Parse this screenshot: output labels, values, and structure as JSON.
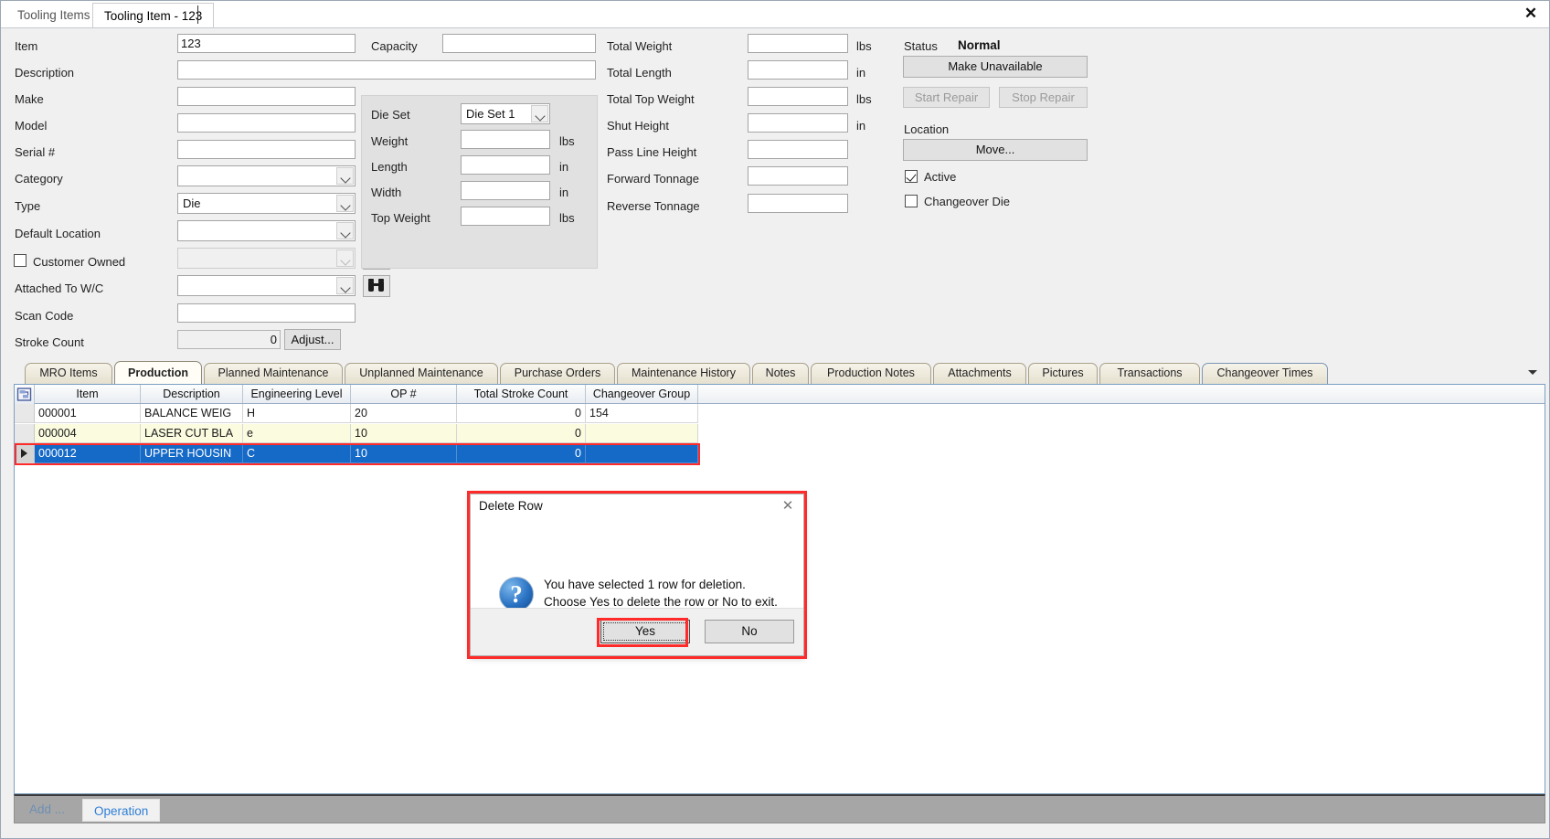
{
  "window": {
    "close_label": "✕"
  },
  "doc_tabs": [
    {
      "label": "Tooling Items",
      "active": false
    },
    {
      "label": "Tooling Item - 123",
      "active": true
    }
  ],
  "form": {
    "left_fields": [
      {
        "label": "Item",
        "value": "123",
        "type": "text"
      },
      {
        "label": "Description",
        "value": "",
        "type": "text"
      },
      {
        "label": "Make",
        "value": "",
        "type": "text"
      },
      {
        "label": "Model",
        "value": "",
        "type": "text"
      },
      {
        "label": "Serial #",
        "value": "",
        "type": "text"
      },
      {
        "label": "Category",
        "value": "",
        "type": "combo"
      },
      {
        "label": "Type",
        "value": "Die",
        "type": "combo"
      },
      {
        "label": "Default Location",
        "value": "",
        "type": "combo"
      },
      {
        "label": "Customer Owned",
        "value": "",
        "type": "checkbox-combo"
      },
      {
        "label": "Attached To W/C",
        "value": "",
        "type": "combo"
      },
      {
        "label": "Scan Code",
        "value": "",
        "type": "text"
      },
      {
        "label": "Stroke Count",
        "value": "0",
        "type": "readonly"
      }
    ],
    "capacity": {
      "label": "Capacity",
      "value": ""
    },
    "adjust_button": "Adjust...",
    "die_set_group": {
      "fields": [
        {
          "label": "Die Set",
          "value": "Die Set 1",
          "unit": "",
          "type": "combo"
        },
        {
          "label": "Weight",
          "value": "",
          "unit": "lbs",
          "type": "text"
        },
        {
          "label": "Length",
          "value": "",
          "unit": "in",
          "type": "text"
        },
        {
          "label": "Width",
          "value": "",
          "unit": "in",
          "type": "text"
        },
        {
          "label": "Top Weight",
          "value": "",
          "unit": "lbs",
          "type": "text"
        }
      ]
    },
    "totals": [
      {
        "label": "Total Weight",
        "value": "",
        "unit": "lbs"
      },
      {
        "label": "Total Length",
        "value": "",
        "unit": "in"
      },
      {
        "label": "Total Top Weight",
        "value": "",
        "unit": "lbs"
      },
      {
        "label": "Shut Height",
        "value": "",
        "unit": "in"
      },
      {
        "label": "Pass Line Height",
        "value": "",
        "unit": ""
      },
      {
        "label": "Forward Tonnage",
        "value": "",
        "unit": ""
      },
      {
        "label": "Reverse Tonnage",
        "value": "",
        "unit": ""
      }
    ],
    "status": {
      "label": "Status",
      "value": "Normal",
      "make_unavailable": "Make Unavailable",
      "start_repair": "Start Repair",
      "stop_repair": "Stop Repair",
      "location_label": "Location",
      "move_button": "Move...",
      "active_label": "Active",
      "active_checked": true,
      "changeover_label": "Changeover Die",
      "changeover_checked": false
    }
  },
  "tabs": [
    {
      "label": "MRO Items",
      "selected": false
    },
    {
      "label": "Production",
      "selected": true
    },
    {
      "label": "Planned Maintenance",
      "selected": false
    },
    {
      "label": "Unplanned Maintenance",
      "selected": false
    },
    {
      "label": "Purchase Orders",
      "selected": false
    },
    {
      "label": "Maintenance History",
      "selected": false
    },
    {
      "label": "Notes",
      "selected": false
    },
    {
      "label": "Production Notes",
      "selected": false
    },
    {
      "label": "Attachments",
      "selected": false
    },
    {
      "label": "Pictures",
      "selected": false
    },
    {
      "label": "Transactions",
      "selected": false
    },
    {
      "label": "Changeover Times",
      "selected": false
    }
  ],
  "grid": {
    "columns": [
      "Item",
      "Description",
      "Engineering Level",
      "OP #",
      "Total Stroke Count",
      "Changeover Group"
    ],
    "rows": [
      {
        "cells": [
          "000001",
          "BALANCE WEIG",
          "H",
          "20",
          "0",
          "154"
        ],
        "style": "row0",
        "selected": false
      },
      {
        "cells": [
          "000004",
          "LASER CUT BLA",
          "e",
          "10",
          "0",
          ""
        ],
        "style": "row1",
        "selected": false
      },
      {
        "cells": [
          "000012",
          "UPPER HOUSIN",
          "C",
          "10",
          "0",
          ""
        ],
        "style": "rowsel",
        "selected": true
      }
    ]
  },
  "bottom": {
    "add_label": "Add ...",
    "operation_label": "Operation"
  },
  "dialog": {
    "title": "Delete Row",
    "close": "✕",
    "message_line1": "You have selected 1 row for deletion.",
    "message_line2": "Choose Yes to delete the row or No to exit.",
    "yes_label": "Yes",
    "no_label": "No"
  },
  "colors": {
    "selection_blue": "#1569c7",
    "highlight_red": "#ff2b2b",
    "alt_row": "#fbfbe0",
    "panel": "#f0f0f0"
  }
}
